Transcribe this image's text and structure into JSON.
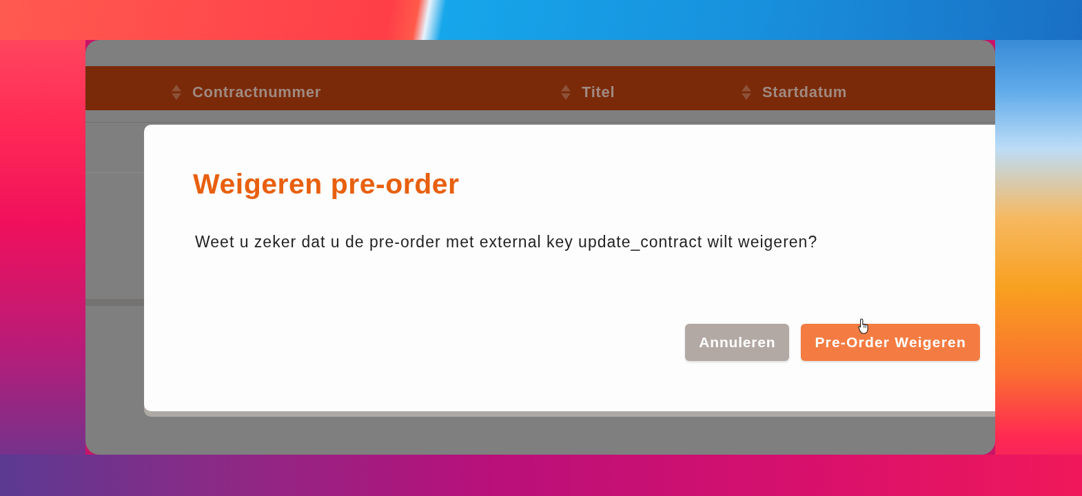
{
  "table": {
    "columns": [
      {
        "label": "Contractnummer"
      },
      {
        "label": "Titel"
      },
      {
        "label": "Startdatum"
      }
    ]
  },
  "dialog": {
    "title": "Weigeren pre-order",
    "message": "Weet u zeker dat u de pre-order met external key update_contract wilt weigeren?",
    "buttons": [
      {
        "label": "Annuleren",
        "kind": "secondary"
      },
      {
        "label": "Pre-Order Weigeren",
        "kind": "primary"
      }
    ]
  }
}
